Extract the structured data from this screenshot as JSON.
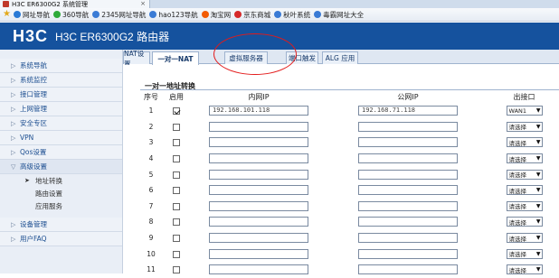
{
  "browser_tab": {
    "title": "H3C ER6300G2 系统管理",
    "close": "×"
  },
  "favorites": [
    {
      "label": "网址导航",
      "color": "#2a7ad6"
    },
    {
      "label": "360导航",
      "color": "#2eaa3a"
    },
    {
      "label": "2345网址导航",
      "color": "#3a7bd5"
    },
    {
      "label": "hao123导航",
      "color": "#3a7bd5"
    },
    {
      "label": "淘宝网",
      "color": "#f25c05"
    },
    {
      "label": "京东商城",
      "color": "#d62a2a"
    },
    {
      "label": "秋叶系统",
      "color": "#3a7bd5"
    },
    {
      "label": "毒霸网址大全",
      "color": "#3a7bd5"
    }
  ],
  "header": {
    "logo": "H3C",
    "title": "H3C ER6300G2 路由器"
  },
  "sidebar": {
    "items": [
      {
        "label": "系统导航"
      },
      {
        "label": "系统监控"
      },
      {
        "label": "接口管理"
      },
      {
        "label": "上网管理"
      },
      {
        "label": "安全专区"
      },
      {
        "label": "VPN"
      },
      {
        "label": "Qos设置"
      },
      {
        "label": "高级设置"
      },
      {
        "label": "地址转换"
      },
      {
        "label": "路由设置"
      },
      {
        "label": "应用服务"
      },
      {
        "label": "设备管理"
      },
      {
        "label": "用户FAQ"
      }
    ]
  },
  "tabs": [
    {
      "label": "NAT设置"
    },
    {
      "label": "一对一NAT"
    },
    {
      "label": "虚拟服务器"
    },
    {
      "label": "端口触发"
    },
    {
      "label": "ALG 应用"
    }
  ],
  "section": {
    "title": "一对一地址转换"
  },
  "table": {
    "headers": {
      "index": "序号",
      "enabled": "启用",
      "inner_ip": "内网IP",
      "public_ip": "公网IP",
      "out_port": "出接口"
    },
    "rows": [
      {
        "index": "1",
        "enabled": true,
        "inner_ip": "192.168.101.118",
        "public_ip": "192.168.71.118",
        "out_port": "WAN1"
      },
      {
        "index": "2",
        "enabled": false,
        "inner_ip": "",
        "public_ip": "",
        "out_port": "请选择"
      },
      {
        "index": "3",
        "enabled": false,
        "inner_ip": "",
        "public_ip": "",
        "out_port": "请选择"
      },
      {
        "index": "4",
        "enabled": false,
        "inner_ip": "",
        "public_ip": "",
        "out_port": "请选择"
      },
      {
        "index": "5",
        "enabled": false,
        "inner_ip": "",
        "public_ip": "",
        "out_port": "请选择"
      },
      {
        "index": "6",
        "enabled": false,
        "inner_ip": "",
        "public_ip": "",
        "out_port": "请选择"
      },
      {
        "index": "7",
        "enabled": false,
        "inner_ip": "",
        "public_ip": "",
        "out_port": "请选择"
      },
      {
        "index": "8",
        "enabled": false,
        "inner_ip": "",
        "public_ip": "",
        "out_port": "请选择"
      },
      {
        "index": "9",
        "enabled": false,
        "inner_ip": "",
        "public_ip": "",
        "out_port": "请选择"
      },
      {
        "index": "10",
        "enabled": false,
        "inner_ip": "",
        "public_ip": "",
        "out_port": "请选择"
      },
      {
        "index": "11",
        "enabled": false,
        "inner_ip": "",
        "public_ip": "",
        "out_port": "请选择"
      }
    ]
  },
  "colors": {
    "header_bg": "#15529e",
    "annotation": "#e31a1a",
    "sidebar_text": "#1d4f91"
  }
}
